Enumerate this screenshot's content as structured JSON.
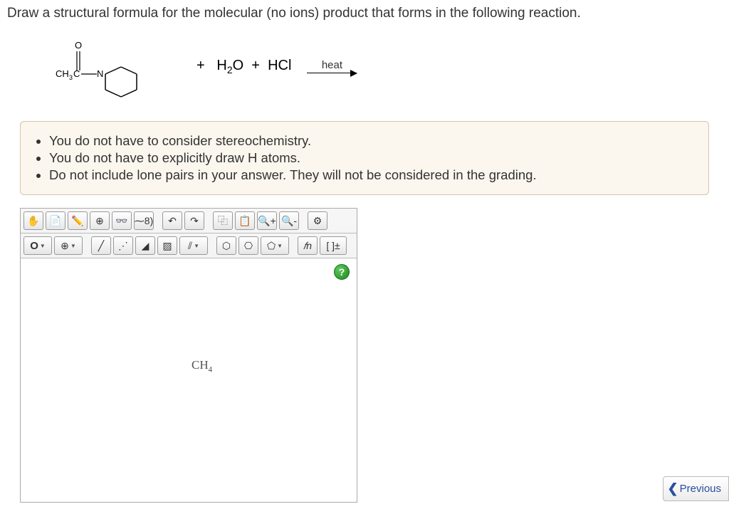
{
  "question_text": "Draw a structural formula for the molecular (no ions) product that forms in the following reaction.",
  "reaction": {
    "plus": "+",
    "reagent1": "H",
    "reagent1_sub": "2",
    "reagent1_tail": "O",
    "reagent2": "HCl",
    "arrow_label": "heat"
  },
  "info": {
    "b1": "You do not have to consider stereochemistry.",
    "b2": "You do not have to explicitly draw H atoms.",
    "b3": "Do not include lone pairs in your answer. They will not be considered in the grading."
  },
  "toolbar": {
    "row1": {
      "hand": "✋",
      "new": "📄",
      "erase": "✏️",
      "target": "⊕",
      "glasses": "👓",
      "lasso": "⁓8)",
      "undo": "↶",
      "redo": "↷",
      "copy": "⿻",
      "paste": "📋",
      "zoom_in": "🔍+",
      "zoom_out": "🔍-",
      "settings": "⚙"
    },
    "row2": {
      "atom_O": "O",
      "charge": "⊕",
      "bond1": "╱",
      "bond_dash": "⋰",
      "bond_wedge_up": "◢",
      "bond_wedge_down": "▨",
      "bond_double": "⫽",
      "ring_benzene": "⬡",
      "ring_cyclohex": "⎔",
      "ring_cyclopent": "⬠",
      "chain": "𝑓n",
      "brackets": "[ ]±"
    }
  },
  "canvas": {
    "help": "?",
    "placed_atom_base": "CH",
    "placed_atom_sub": "4"
  },
  "nav": {
    "previous": "Previous"
  }
}
